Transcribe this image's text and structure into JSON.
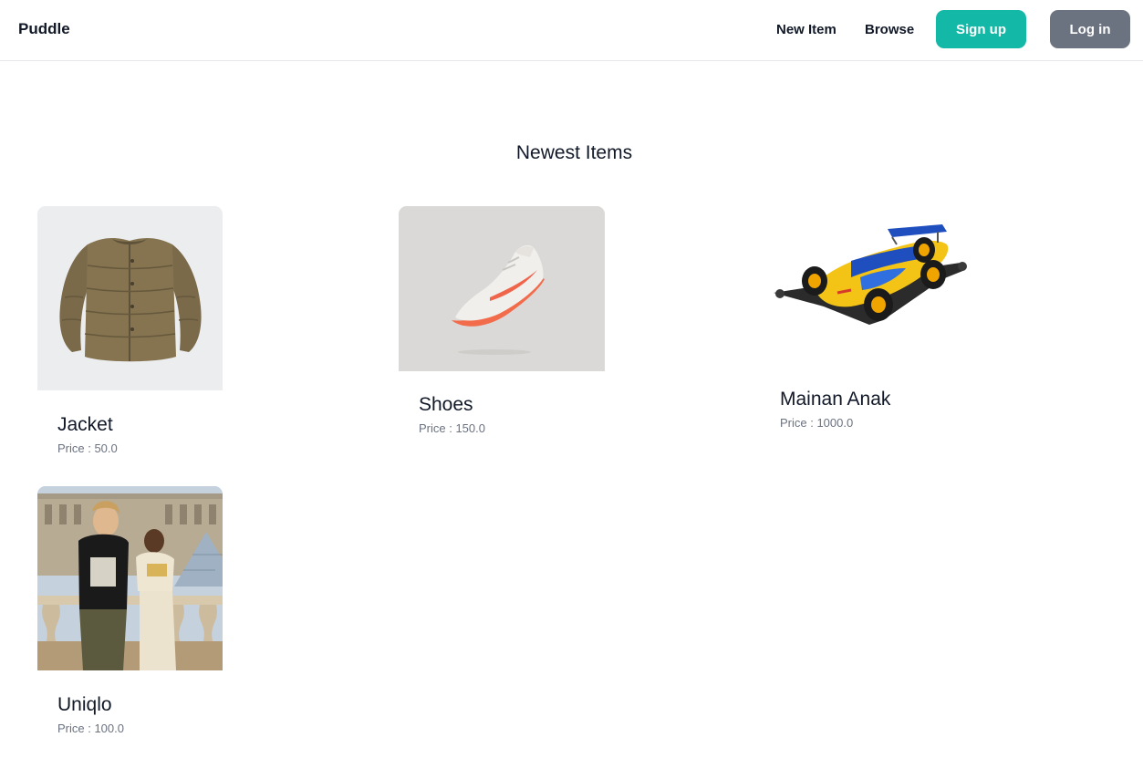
{
  "navbar": {
    "brand": "Puddle",
    "links": {
      "new_item": "New Item",
      "browse": "Browse"
    },
    "buttons": {
      "signup": "Sign up",
      "login": "Log in"
    },
    "colors": {
      "signup_bg": "#14b8a6",
      "login_bg": "#6b7280"
    }
  },
  "main": {
    "title": "Newest Items",
    "items": [
      {
        "name": "Jacket",
        "price": "Price : 50.0",
        "image": "olive-puffer-jacket-photo"
      },
      {
        "name": "Shoes",
        "price": "Price : 150.0",
        "image": "white-orange-sneaker-photo"
      },
      {
        "name": "Mainan Anak",
        "price": "Price : 1000.0",
        "image": "yellow-blue-mini-4wd-car-photo"
      },
      {
        "name": "Uniqlo",
        "price": "Price : 100.0",
        "image": "two-men-at-louvre-photo"
      }
    ]
  }
}
